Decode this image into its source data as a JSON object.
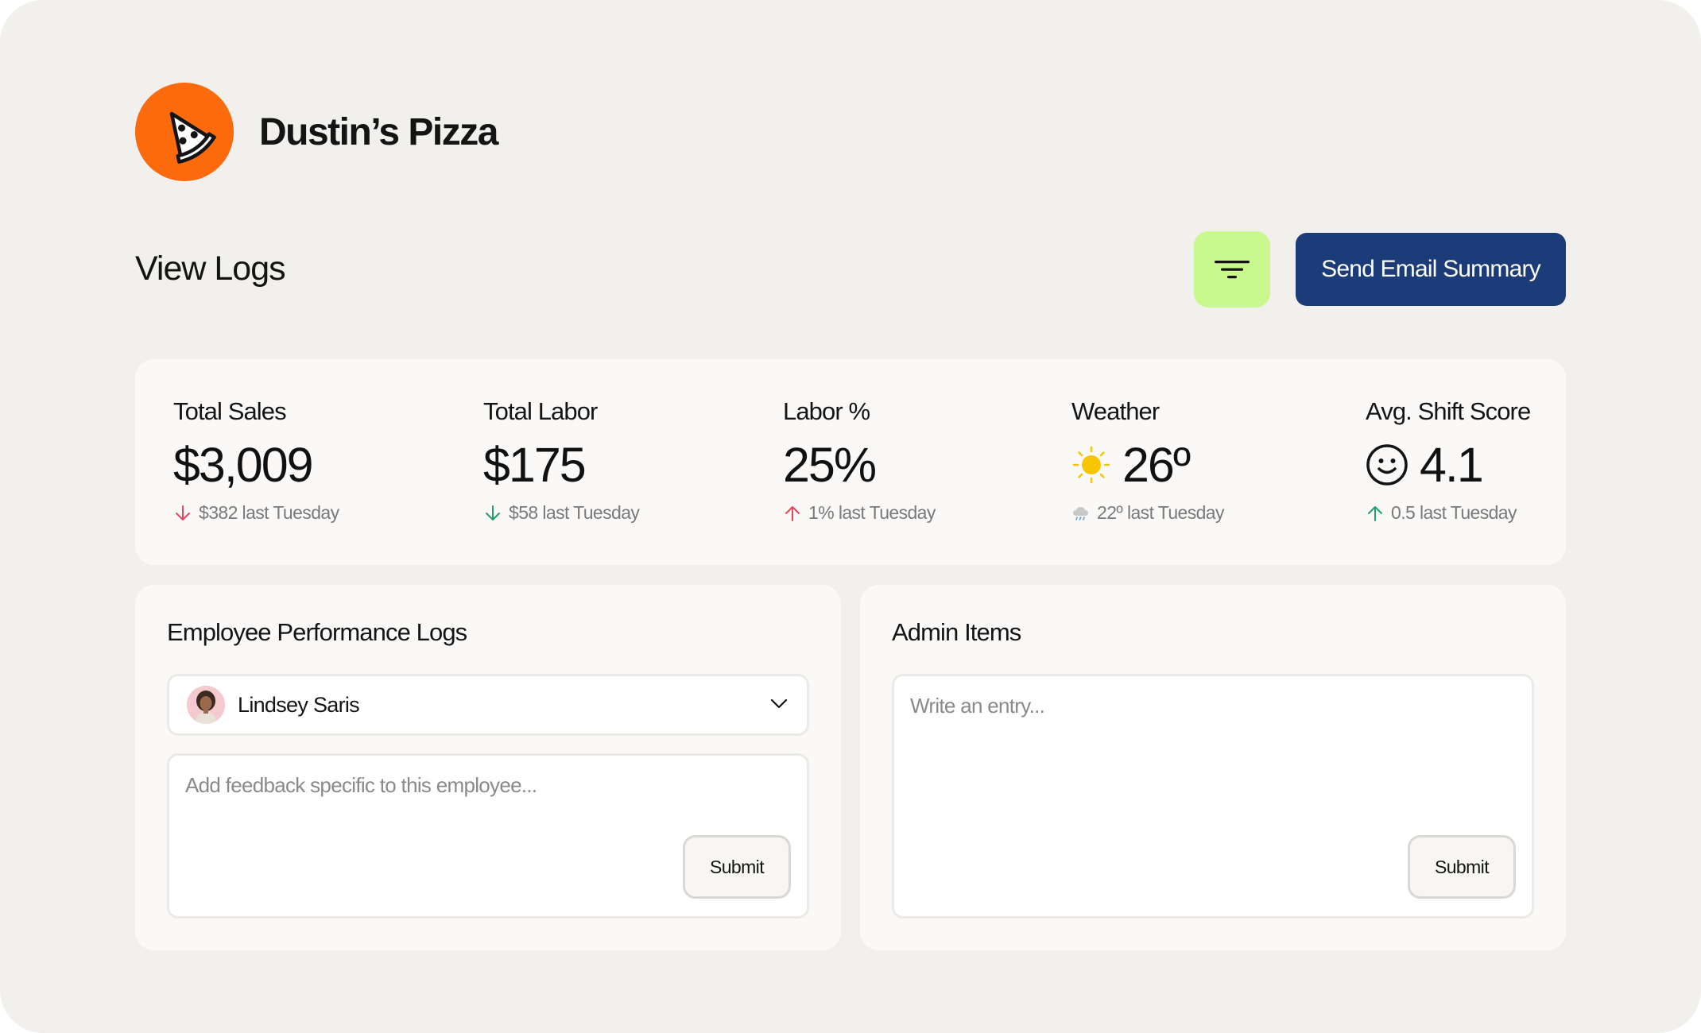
{
  "brand": {
    "name": "Dustin’s Pizza",
    "logo_icon": "pizza-slice-icon",
    "logo_color": "#fb6a0d"
  },
  "header": {
    "title": "View Logs",
    "filter_icon": "filter-icon",
    "email_button": "Send Email Summary"
  },
  "colors": {
    "accent": "#1b3c79",
    "filter_bg": "#c9f98e",
    "down": "#e5485d",
    "up": "#22a06b"
  },
  "stats": [
    {
      "label": "Total Sales",
      "value": "$3,009",
      "change": "$382 last Tuesday",
      "direction": "down"
    },
    {
      "label": "Total Labor",
      "value": "$175",
      "change": "$58 last Tuesday",
      "direction": "down"
    },
    {
      "label": "Labor %",
      "value": "25%",
      "change": "1% last Tuesday",
      "direction": "up"
    },
    {
      "label": "Weather",
      "value": "26º",
      "value_icon": "sun-icon",
      "change": "22º last Tuesday",
      "change_icon": "rain-cloud-icon"
    },
    {
      "label": "Avg. Shift Score",
      "value": "4.1",
      "value_icon": "smiley-icon",
      "change": "0.5 last Tuesday",
      "direction": "up"
    }
  ],
  "employee_logs": {
    "title": "Employee Performance Logs",
    "selected_employee": "Lindsey Saris",
    "feedback_placeholder": "Add feedback specific to this employee...",
    "submit_label": "Submit"
  },
  "admin_items": {
    "title": "Admin Items",
    "entry_placeholder": "Write an entry...",
    "submit_label": "Submit"
  }
}
